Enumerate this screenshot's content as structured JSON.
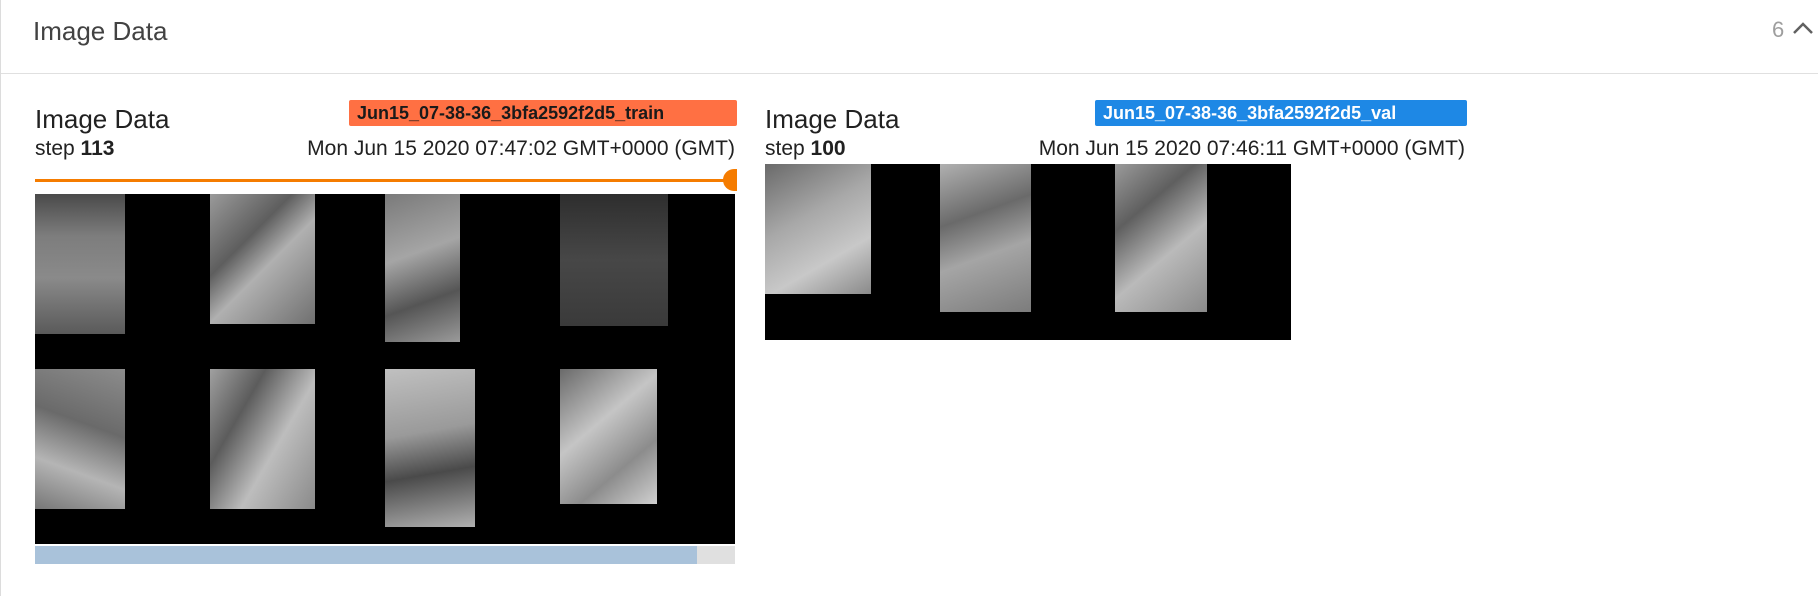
{
  "panel": {
    "title": "Image Data",
    "count": "6",
    "collapse_icon": "chevron-up-icon"
  },
  "cards": [
    {
      "title": "Image Data",
      "step_label": "step",
      "step_value": "113",
      "timestamp": "Mon Jun 15 2020 07:47:02 GMT+0000 (GMT)",
      "run_tag": "Jun15_07-38-36_3bfa2592f2d5_train",
      "run_color": "#ff7043",
      "slider_color": "#f57c00",
      "scroll_fraction": 0.945
    },
    {
      "title": "Image Data",
      "step_label": "step",
      "step_value": "100",
      "timestamp": "Mon Jun 15 2020 07:46:11 GMT+0000 (GMT)",
      "run_tag": "Jun15_07-38-36_3bfa2592f2d5_val",
      "run_color": "#1e88e5"
    }
  ]
}
